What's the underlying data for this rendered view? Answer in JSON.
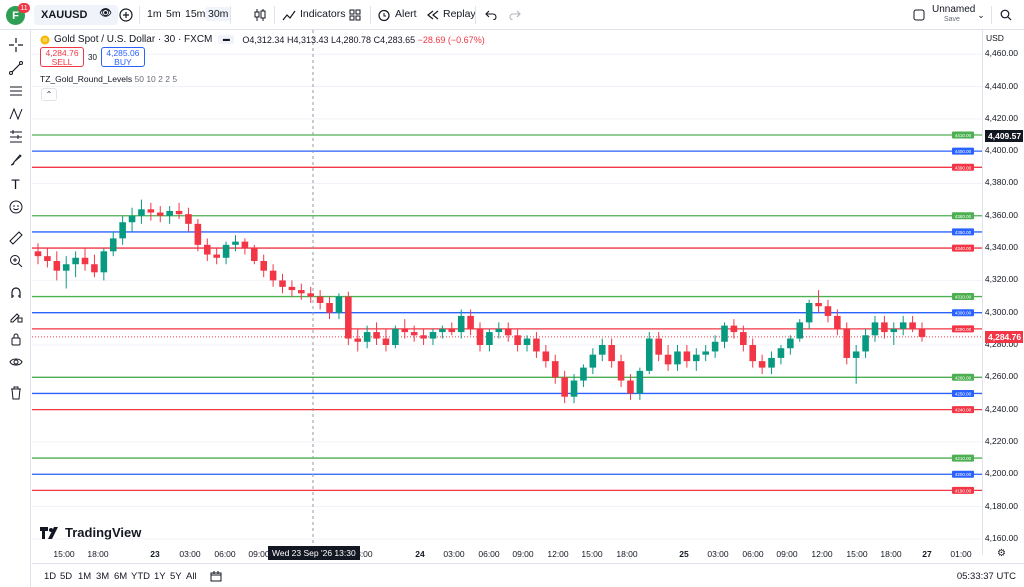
{
  "topbar": {
    "avatar_letter": "F",
    "avatar_badge": "11",
    "symbol": "XAUUSD",
    "timeframes": [
      "1m",
      "5m",
      "15m",
      "30m"
    ],
    "active_timeframe": "30m",
    "indicators_label": "Indicators",
    "alert_label": "Alert",
    "replay_label": "Replay",
    "layout_name": "Unnamed",
    "layout_sub": "Save"
  },
  "legend": {
    "title": "Gold Spot / U.S. Dollar · 30 · FXCM",
    "open": "O4,312.34",
    "high": "H4,313.43",
    "low": "L4,280.78",
    "close": "C4,283.65",
    "change": "−28.69 (−0.67%)",
    "sell_price": "4,284.76",
    "sell_label": "SELL",
    "spread": "30",
    "buy_price": "4,285.06",
    "buy_label": "BUY",
    "indicator_name": "TZ_Gold_Round_Levels",
    "indicator_params": "50 10 2 2 5"
  },
  "price_axis": {
    "currency": "USD",
    "current_price": "4,284.76",
    "crosshair_price": "4,409.57"
  },
  "chart_data": {
    "type": "candlestick",
    "title": "Gold Spot / U.S. Dollar · 30 · FXCM",
    "ylim": [
      4150,
      4475
    ],
    "y_ticks": [
      4160,
      4180,
      4200,
      4220,
      4240,
      4260,
      4280,
      4300,
      4320,
      4340,
      4360,
      4380,
      4400,
      4420,
      4440,
      4460
    ],
    "x_ticks": [
      "15:00",
      "18:00",
      "23",
      "03:00",
      "06:00",
      "09:00",
      "18:00",
      "24",
      "03:00",
      "06:00",
      "09:00",
      "12:00",
      "15:00",
      "18:00",
      "25",
      "03:00",
      "06:00",
      "09:00",
      "12:00",
      "15:00",
      "18:00",
      "27",
      "01:00"
    ],
    "crosshair_time": "Wed 23 Sep '26   13:30",
    "levels": [
      {
        "price": 4410,
        "label": "4410.00",
        "color": "#4caf50"
      },
      {
        "price": 4400,
        "label": "4400.00",
        "color": "#2962ff"
      },
      {
        "price": 4390,
        "label": "4390.00",
        "color": "#f23645"
      },
      {
        "price": 4360,
        "label": "4360.00",
        "color": "#4caf50"
      },
      {
        "price": 4350,
        "label": "4350.00",
        "color": "#2962ff"
      },
      {
        "price": 4340,
        "label": "4340.00",
        "color": "#f23645"
      },
      {
        "price": 4310,
        "label": "4310.00",
        "color": "#4caf50"
      },
      {
        "price": 4300,
        "label": "4300.00",
        "color": "#2962ff"
      },
      {
        "price": 4290,
        "label": "4290.00",
        "color": "#f23645"
      },
      {
        "price": 4260,
        "label": "4260.00",
        "color": "#4caf50"
      },
      {
        "price": 4250,
        "label": "4250.00",
        "color": "#2962ff"
      },
      {
        "price": 4240,
        "label": "4240.00",
        "color": "#f23645"
      },
      {
        "price": 4210,
        "label": "4210.00",
        "color": "#4caf50"
      },
      {
        "price": 4200,
        "label": "4200.00",
        "color": "#2962ff"
      },
      {
        "price": 4190,
        "label": "4190.00",
        "color": "#f23645"
      }
    ],
    "candles": [
      [
        4338,
        4343,
        4330,
        4335
      ],
      [
        4335,
        4340,
        4328,
        4332
      ],
      [
        4332,
        4338,
        4320,
        4326
      ],
      [
        4326,
        4335,
        4315,
        4330
      ],
      [
        4330,
        4338,
        4322,
        4334
      ],
      [
        4334,
        4340,
        4326,
        4330
      ],
      [
        4330,
        4336,
        4322,
        4325
      ],
      [
        4325,
        4340,
        4320,
        4338
      ],
      [
        4338,
        4350,
        4335,
        4346
      ],
      [
        4346,
        4360,
        4342,
        4356
      ],
      [
        4356,
        4365,
        4350,
        4360
      ],
      [
        4360,
        4370,
        4355,
        4364
      ],
      [
        4364,
        4368,
        4357,
        4362
      ],
      [
        4362,
        4366,
        4356,
        4360
      ],
      [
        4360,
        4366,
        4355,
        4363
      ],
      [
        4363,
        4368,
        4358,
        4361
      ],
      [
        4361,
        4365,
        4350,
        4355
      ],
      [
        4355,
        4358,
        4338,
        4342
      ],
      [
        4342,
        4346,
        4332,
        4336
      ],
      [
        4336,
        4340,
        4330,
        4334
      ],
      [
        4334,
        4344,
        4330,
        4342
      ],
      [
        4342,
        4348,
        4338,
        4344
      ],
      [
        4344,
        4346,
        4336,
        4340
      ],
      [
        4340,
        4342,
        4330,
        4332
      ],
      [
        4332,
        4336,
        4322,
        4326
      ],
      [
        4326,
        4330,
        4316,
        4320
      ],
      [
        4320,
        4324,
        4312,
        4316
      ],
      [
        4316,
        4320,
        4310,
        4314
      ],
      [
        4314,
        4318,
        4308,
        4312
      ],
      [
        4312,
        4316,
        4306,
        4310
      ],
      [
        4310,
        4314,
        4302,
        4306
      ],
      [
        4306,
        4310,
        4296,
        4300
      ],
      [
        4300,
        4312,
        4296,
        4310
      ],
      [
        4310,
        4313,
        4280,
        4284
      ],
      [
        4284,
        4290,
        4276,
        4282
      ],
      [
        4282,
        4292,
        4278,
        4288
      ],
      [
        4288,
        4294,
        4280,
        4284
      ],
      [
        4284,
        4290,
        4276,
        4280
      ],
      [
        4280,
        4292,
        4278,
        4290
      ],
      [
        4290,
        4296,
        4284,
        4288
      ],
      [
        4288,
        4292,
        4282,
        4286
      ],
      [
        4286,
        4290,
        4280,
        4284
      ],
      [
        4284,
        4290,
        4280,
        4288
      ],
      [
        4288,
        4292,
        4284,
        4290
      ],
      [
        4290,
        4294,
        4286,
        4288
      ],
      [
        4288,
        4302,
        4284,
        4298
      ],
      [
        4298,
        4302,
        4286,
        4290
      ],
      [
        4290,
        4294,
        4276,
        4280
      ],
      [
        4280,
        4290,
        4276,
        4288
      ],
      [
        4288,
        4294,
        4284,
        4290
      ],
      [
        4290,
        4294,
        4282,
        4286
      ],
      [
        4286,
        4290,
        4276,
        4280
      ],
      [
        4280,
        4286,
        4276,
        4284
      ],
      [
        4284,
        4288,
        4272,
        4276
      ],
      [
        4276,
        4280,
        4266,
        4270
      ],
      [
        4270,
        4274,
        4256,
        4260
      ],
      [
        4260,
        4264,
        4244,
        4248
      ],
      [
        4248,
        4262,
        4244,
        4258
      ],
      [
        4258,
        4268,
        4254,
        4266
      ],
      [
        4266,
        4278,
        4262,
        4274
      ],
      [
        4274,
        4284,
        4270,
        4280
      ],
      [
        4280,
        4284,
        4266,
        4270
      ],
      [
        4270,
        4274,
        4254,
        4258
      ],
      [
        4258,
        4262,
        4246,
        4250
      ],
      [
        4250,
        4266,
        4246,
        4264
      ],
      [
        4264,
        4288,
        4262,
        4284
      ],
      [
        4284,
        4288,
        4270,
        4274
      ],
      [
        4274,
        4280,
        4264,
        4268
      ],
      [
        4268,
        4280,
        4264,
        4276
      ],
      [
        4276,
        4280,
        4266,
        4270
      ],
      [
        4270,
        4278,
        4264,
        4274
      ],
      [
        4274,
        4280,
        4270,
        4276
      ],
      [
        4276,
        4286,
        4272,
        4282
      ],
      [
        4282,
        4294,
        4278,
        4292
      ],
      [
        4292,
        4296,
        4284,
        4288
      ],
      [
        4288,
        4292,
        4276,
        4280
      ],
      [
        4280,
        4284,
        4266,
        4270
      ],
      [
        4270,
        4274,
        4262,
        4266
      ],
      [
        4266,
        4276,
        4262,
        4272
      ],
      [
        4272,
        4280,
        4268,
        4278
      ],
      [
        4278,
        4286,
        4274,
        4284
      ],
      [
        4284,
        4296,
        4282,
        4294
      ],
      [
        4294,
        4308,
        4290,
        4306
      ],
      [
        4306,
        4314,
        4300,
        4304
      ],
      [
        4304,
        4308,
        4294,
        4298
      ],
      [
        4298,
        4302,
        4286,
        4290
      ],
      [
        4290,
        4294,
        4268,
        4272
      ],
      [
        4272,
        4280,
        4256,
        4276
      ],
      [
        4276,
        4290,
        4272,
        4286
      ],
      [
        4286,
        4298,
        4282,
        4294
      ],
      [
        4294,
        4298,
        4284,
        4288
      ],
      [
        4288,
        4294,
        4280,
        4290
      ],
      [
        4290,
        4298,
        4286,
        4294
      ],
      [
        4294,
        4298,
        4288,
        4290
      ],
      [
        4290,
        4294,
        4282,
        4285
      ]
    ]
  },
  "time_ticks": [
    {
      "label": "15:00",
      "x": 64,
      "bold": false
    },
    {
      "label": "18:00",
      "x": 98,
      "bold": false
    },
    {
      "label": "23",
      "x": 155,
      "bold": true
    },
    {
      "label": "03:00",
      "x": 190,
      "bold": false
    },
    {
      "label": "06:00",
      "x": 225,
      "bold": false
    },
    {
      "label": "09:00",
      "x": 259,
      "bold": false
    },
    {
      "label": "18:00",
      "x": 362,
      "bold": false
    },
    {
      "label": "24",
      "x": 420,
      "bold": true
    },
    {
      "label": "03:00",
      "x": 454,
      "bold": false
    },
    {
      "label": "06:00",
      "x": 489,
      "bold": false
    },
    {
      "label": "09:00",
      "x": 523,
      "bold": false
    },
    {
      "label": "12:00",
      "x": 558,
      "bold": false
    },
    {
      "label": "15:00",
      "x": 592,
      "bold": false
    },
    {
      "label": "18:00",
      "x": 627,
      "bold": false
    },
    {
      "label": "25",
      "x": 684,
      "bold": true
    },
    {
      "label": "03:00",
      "x": 718,
      "bold": false
    },
    {
      "label": "06:00",
      "x": 753,
      "bold": false
    },
    {
      "label": "09:00",
      "x": 787,
      "bold": false
    },
    {
      "label": "12:00",
      "x": 822,
      "bold": false
    },
    {
      "label": "15:00",
      "x": 857,
      "bold": false
    },
    {
      "label": "18:00",
      "x": 891,
      "bold": false
    },
    {
      "label": "27",
      "x": 927,
      "bold": true
    },
    {
      "label": "01:00",
      "x": 961,
      "bold": false
    }
  ],
  "bottombar": {
    "ranges": [
      "1D",
      "5D",
      "1M",
      "3M",
      "6M",
      "YTD",
      "1Y",
      "5Y",
      "All"
    ],
    "clock": "05:33:37 UTC"
  },
  "brand": "TradingView",
  "colors": {
    "up": "#089981",
    "down": "#f23645",
    "green_level": "#4caf50",
    "blue_level": "#2962ff",
    "red_level": "#f23645"
  }
}
